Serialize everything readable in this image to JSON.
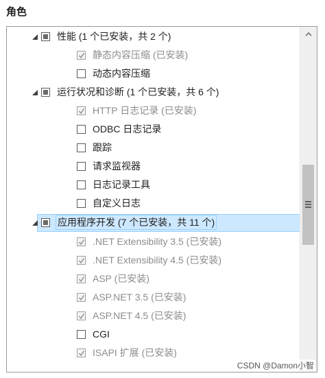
{
  "header": {
    "title": "角色"
  },
  "tree": {
    "items": [
      {
        "level": 0,
        "state": "partial",
        "label": "性能 (1 个已安装，共 2 个)",
        "disabled": false
      },
      {
        "level": 1,
        "state": "checked",
        "label": "静态内容压缩 (已安装)",
        "disabled": true
      },
      {
        "level": 1,
        "state": "unchecked",
        "label": "动态内容压缩",
        "disabled": false
      },
      {
        "level": 0,
        "state": "partial",
        "label": "运行状况和诊断 (1 个已安装，共 6 个)",
        "disabled": false
      },
      {
        "level": 1,
        "state": "checked",
        "label": "HTTP 日志记录 (已安装)",
        "disabled": true
      },
      {
        "level": 1,
        "state": "unchecked",
        "label": "ODBC 日志记录",
        "disabled": false
      },
      {
        "level": 1,
        "state": "unchecked",
        "label": "跟踪",
        "disabled": false
      },
      {
        "level": 1,
        "state": "unchecked",
        "label": "请求监视器",
        "disabled": false
      },
      {
        "level": 1,
        "state": "unchecked",
        "label": "日志记录工具",
        "disabled": false
      },
      {
        "level": 1,
        "state": "unchecked",
        "label": "自定义日志",
        "disabled": false
      },
      {
        "level": 0,
        "state": "partial",
        "label": "应用程序开发 (7 个已安装，共 11 个)",
        "disabled": false,
        "selected": true
      },
      {
        "level": 1,
        "state": "checked",
        "label": ".NET Extensibility 3.5 (已安装)",
        "disabled": true
      },
      {
        "level": 1,
        "state": "checked",
        "label": ".NET Extensibility 4.5 (已安装)",
        "disabled": true
      },
      {
        "level": 1,
        "state": "checked",
        "label": "ASP (已安装)",
        "disabled": true
      },
      {
        "level": 1,
        "state": "checked",
        "label": "ASP.NET 3.5 (已安装)",
        "disabled": true
      },
      {
        "level": 1,
        "state": "checked",
        "label": "ASP.NET 4.5 (已安装)",
        "disabled": true
      },
      {
        "level": 1,
        "state": "unchecked",
        "label": "CGI",
        "disabled": false
      },
      {
        "level": 1,
        "state": "checked",
        "label": "ISAPI 扩展 (已安装)",
        "disabled": true
      }
    ]
  },
  "watermark": "CSDN @Damon小智",
  "colors": {
    "selection": "#cce8ff",
    "selection_border": "#99d1ff",
    "disabled_text": "#8c8c8c"
  }
}
